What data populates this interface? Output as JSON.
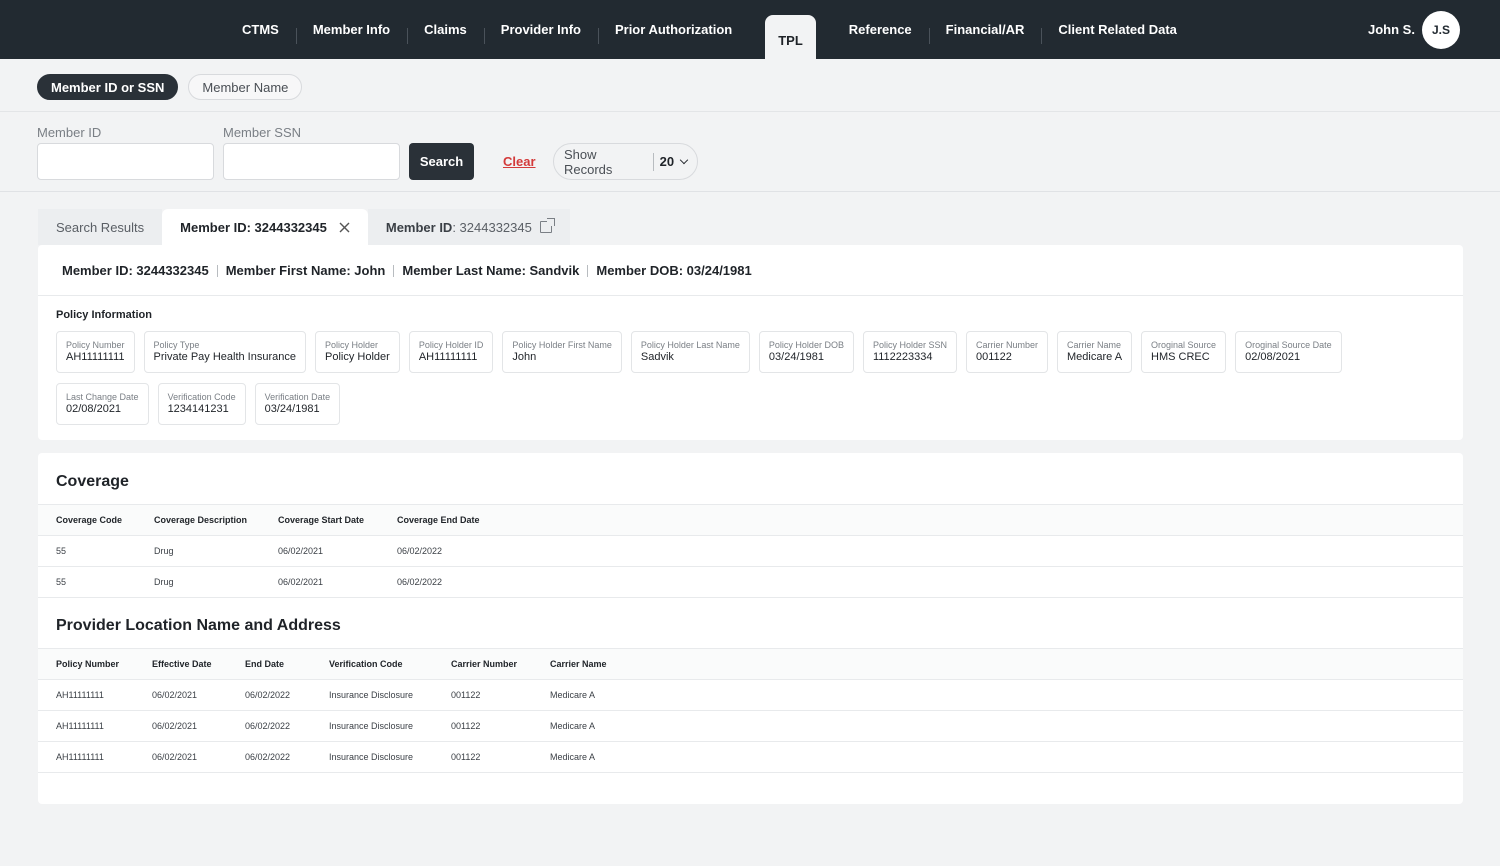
{
  "nav": {
    "items": [
      "CTMS",
      "Member Info",
      "Claims",
      "Provider Info",
      "Prior Authorization",
      "TPL",
      "Reference",
      "Financial/AR",
      "Client Related Data"
    ],
    "active": "TPL"
  },
  "user": {
    "name": "John S.",
    "initials": "J.S"
  },
  "search_mode": {
    "options": [
      "Member ID or SSN",
      "Member Name"
    ],
    "active": "Member ID or SSN"
  },
  "search": {
    "member_id_label": "Member ID",
    "member_id_value": "",
    "member_ssn_label": "Member SSN",
    "member_ssn_value": "",
    "search_label": "Search",
    "clear_label": "Clear",
    "show_records_label": "Show Records",
    "show_records_value": "20"
  },
  "tabs": {
    "search_results": "Search Results",
    "active_tab": "Member ID: 3244332345",
    "other_tab_key": "Member ID",
    "other_tab_value": ": 3244332345"
  },
  "member_summary": {
    "member_id": "Member ID: 3244332345",
    "first_name": "Member First Name: John",
    "last_name": "Member Last Name: Sandvik",
    "dob": "Member DOB: 03/24/1981"
  },
  "policy": {
    "title": "Policy Information",
    "row1": [
      {
        "label": "Policy Number",
        "value": "AH11111111"
      },
      {
        "label": "Policy Type",
        "value": "Private Pay Health Insurance"
      },
      {
        "label": "Policy Holder",
        "value": "Policy Holder"
      },
      {
        "label": "Policy Holder ID",
        "value": "AH11111111"
      },
      {
        "label": "Policy Holder First Name",
        "value": "John"
      },
      {
        "label": "Policy Holder Last Name",
        "value": "Sadvik"
      },
      {
        "label": "Policy Holder DOB",
        "value": "03/24/1981"
      },
      {
        "label": "Policy Holder SSN",
        "value": "1112223334"
      },
      {
        "label": "Carrier Number",
        "value": "001122"
      },
      {
        "label": "Carrier Name",
        "value": "Medicare A"
      },
      {
        "label": "Oroginal Source",
        "value": "HMS CREC"
      },
      {
        "label": "Oroginal Source Date",
        "value": "02/08/2021"
      }
    ],
    "row2": [
      {
        "label": "Last Change Date",
        "value": "02/08/2021"
      },
      {
        "label": "Verification Code",
        "value": "1234141231"
      },
      {
        "label": "Verification Date",
        "value": "03/24/1981"
      }
    ]
  },
  "coverage": {
    "title": "Coverage",
    "headers": [
      "Coverage Code",
      "Coverage Description",
      "Coverage Start Date",
      "Coverage End Date"
    ],
    "rows": [
      [
        "55",
        "Drug",
        "06/02/2021",
        "06/02/2022"
      ],
      [
        "55",
        "Drug",
        "06/02/2021",
        "06/02/2022"
      ]
    ]
  },
  "provider": {
    "title": "Provider Location Name and Address",
    "headers": [
      "Policy Number",
      "Effective Date",
      "End Date",
      "Verification Code",
      "Carrier Number",
      "Carrier Name"
    ],
    "rows": [
      [
        "AH11111111",
        "06/02/2021",
        "06/02/2022",
        "Insurance Disclosure",
        "001122",
        "Medicare A"
      ],
      [
        "AH11111111",
        "06/02/2021",
        "06/02/2022",
        "Insurance Disclosure",
        "001122",
        "Medicare A"
      ],
      [
        "AH11111111",
        "06/02/2021",
        "06/02/2022",
        "Insurance Disclosure",
        "001122",
        "Medicare A"
      ]
    ]
  }
}
